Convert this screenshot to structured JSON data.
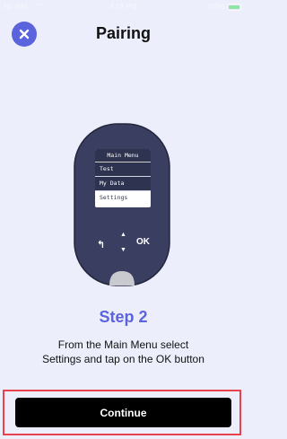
{
  "status_bar": {
    "carrier": "No SIM",
    "time": "4:18 PM",
    "battery": "100%"
  },
  "header": {
    "title": "Pairing",
    "close_icon": "close-icon"
  },
  "device": {
    "menu_title": "Main Menu",
    "menu_items": [
      "Test",
      "My Data",
      "Settings"
    ],
    "selected_item": "Settings",
    "ok_label": "OK"
  },
  "step": {
    "heading": "Step 2",
    "line1": "From the Main Menu select",
    "line2": "Settings and tap on the OK button"
  },
  "footer": {
    "continue_label": "Continue"
  },
  "colors": {
    "accent": "#5b63dd",
    "background": "#eceefb",
    "device_body": "#3a3f62",
    "button": "#000000",
    "highlight": "#e8424f"
  }
}
